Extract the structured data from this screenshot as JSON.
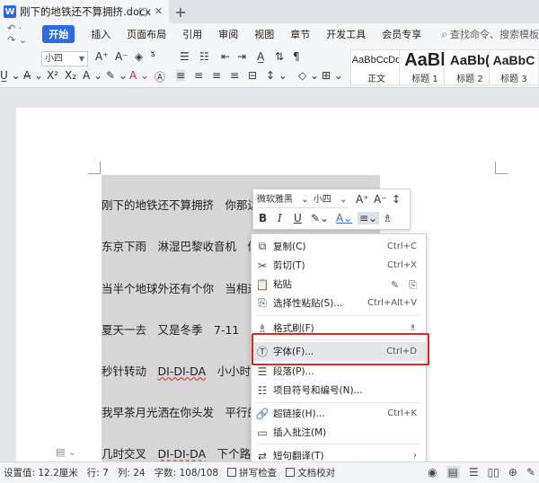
{
  "titlebar": {
    "doc_icon": "W",
    "doc_name": "刚下的地铁还不算拥挤.docx",
    "pin_icon": "□",
    "close_icon": "✕",
    "new_tab": "+"
  },
  "menubar": {
    "quick_access": "↶ · ↷ ⌄",
    "items": [
      {
        "label": "开始",
        "active": true
      },
      {
        "label": "插入"
      },
      {
        "label": "页面布局"
      },
      {
        "label": "引用"
      },
      {
        "label": "审阅"
      },
      {
        "label": "视图"
      },
      {
        "label": "章节"
      },
      {
        "label": "开发工具"
      },
      {
        "label": "会员专享"
      }
    ],
    "search_icon": "⌕",
    "search_placeholder": "查找命令、搜索模板"
  },
  "ribbon": {
    "font_size": "小四",
    "styles": [
      {
        "sample": "AaBbCcDd",
        "label": "正文"
      },
      {
        "sample": "AaBl",
        "label": "标题 1"
      },
      {
        "sample": "AaBb(",
        "label": "标题 2"
      },
      {
        "sample": "AaBbC",
        "label": "标题 3"
      }
    ]
  },
  "document": {
    "lines": [
      {
        "text": "刚下的地铁还不算拥挤　你那边",
        "underline": ""
      },
      {
        "text": "东京下雨　淋湿巴黎收音机　你",
        "underline": ""
      },
      {
        "text": "当半个地球外还有个你　当相遇",
        "underline": ""
      },
      {
        "text": "夏天一去　又是冬季　7-11　暖",
        "underline": ""
      },
      {
        "text": "秒针转动　",
        "underline": "DI-DI-DA",
        "tail": "　小小时差"
      },
      {
        "text": "我早茶月光洒在你头发　平行的",
        "underline": ""
      },
      {
        "text": "几时交叉　",
        "underline": "DI-DI-DA",
        "tail": "　下个路口"
      }
    ]
  },
  "mini_toolbar": {
    "font_name": "微软雅黑",
    "font_size": "小四",
    "grow_font": "A⁺",
    "shrink_font": "A⁻",
    "line_spacing": "↕"
  },
  "context_menu": {
    "items": [
      {
        "icon": "copy-icon",
        "label": "复制(C)",
        "shortcut": "Ctrl+C"
      },
      {
        "icon": "scissors-icon",
        "label": "剪切(T)",
        "shortcut": "Ctrl+X"
      },
      {
        "icon": "paste-icon",
        "label": "粘贴",
        "shortcut": ""
      },
      {
        "icon": "paste-special-icon",
        "label": "选择性粘贴(S)...",
        "shortcut": "Ctrl+Alt+V"
      },
      {
        "icon": "format-brush-icon",
        "label": "格式刷(F)",
        "shortcut": ""
      },
      {
        "icon": "font-icon",
        "label": "字体(F)...",
        "shortcut": "Ctrl+D",
        "highlighted": true
      },
      {
        "icon": "paragraph-icon",
        "label": "段落(P)...",
        "shortcut": ""
      },
      {
        "icon": "list-icon",
        "label": "项目符号和编号(N)...",
        "shortcut": ""
      },
      {
        "icon": "hyperlink-icon",
        "label": "超链接(H)...",
        "shortcut": "Ctrl+K"
      },
      {
        "icon": "comment-icon",
        "label": "插入批注(M)",
        "shortcut": ""
      },
      {
        "icon": "translate-icon",
        "label": "短句翻译(T)",
        "shortcut": ""
      }
    ]
  },
  "statusbar": {
    "position": "设置值: 12.2厘米",
    "row": "行: 7",
    "col": "列: 24",
    "word_count": "字数: 108/108",
    "spell_check": "拼写检查",
    "doc_check": "文档校对"
  },
  "colors": {
    "accent": "#2d6ae3",
    "highlight_frame": "#e0261f",
    "selection": "#d6d6d6"
  }
}
